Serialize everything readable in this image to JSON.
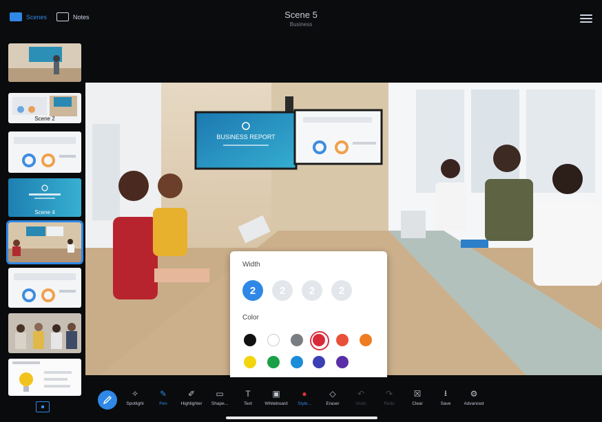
{
  "topbar": {
    "scenes_label": "Scenes",
    "notes_label": "Notes",
    "title": "Scene 5",
    "subtitle": "Business"
  },
  "sidebar": {
    "thumbnails": [
      {
        "caption": ""
      },
      {
        "caption": "Scene 2"
      },
      {
        "caption": ""
      },
      {
        "caption": "Scene 4"
      },
      {
        "caption": ""
      },
      {
        "caption": ""
      },
      {
        "caption": ""
      },
      {
        "caption": ""
      }
    ]
  },
  "stage": {
    "screen_title": "BUSINESS REPORT"
  },
  "popup": {
    "width_label": "Width",
    "color_label": "Color",
    "widths": [
      "2",
      "2",
      "2",
      "2"
    ],
    "selected_width_index": 0,
    "colors": [
      "#111111",
      "#ffffff",
      "#7a7d82",
      "#d92a3a",
      "#e8503a",
      "#ee7d22",
      "#f2d50d",
      "#1aa046",
      "#1a8cd8",
      "#3b3fb3",
      "#5a2ea6"
    ],
    "selected_color_index": 3
  },
  "toolbar": {
    "tools": [
      {
        "label": "Spotlight",
        "icon": "spotlight-icon",
        "state": "normal"
      },
      {
        "label": "Pen",
        "icon": "pen-icon",
        "state": "active"
      },
      {
        "label": "Highlighter",
        "icon": "highlighter-icon",
        "state": "normal"
      },
      {
        "label": "Shape...",
        "icon": "shape-icon",
        "state": "normal"
      },
      {
        "label": "Text",
        "icon": "text-icon",
        "state": "normal"
      },
      {
        "label": "Whiteboard",
        "icon": "whiteboard-icon",
        "state": "normal"
      },
      {
        "label": "Style...",
        "icon": "style-icon",
        "state": "active"
      },
      {
        "label": "Eraser",
        "icon": "eraser-icon",
        "state": "normal"
      },
      {
        "label": "Undo",
        "icon": "undo-icon",
        "state": "disabled"
      },
      {
        "label": "Redo",
        "icon": "redo-icon",
        "state": "disabled"
      },
      {
        "label": "Clear",
        "icon": "trash-icon",
        "state": "normal"
      },
      {
        "label": "Save",
        "icon": "save-icon",
        "state": "normal"
      },
      {
        "label": "Advanced",
        "icon": "advanced-icon",
        "state": "normal"
      }
    ]
  },
  "colors": {
    "accent": "#2f88e6",
    "background": "#0a0b0d"
  }
}
